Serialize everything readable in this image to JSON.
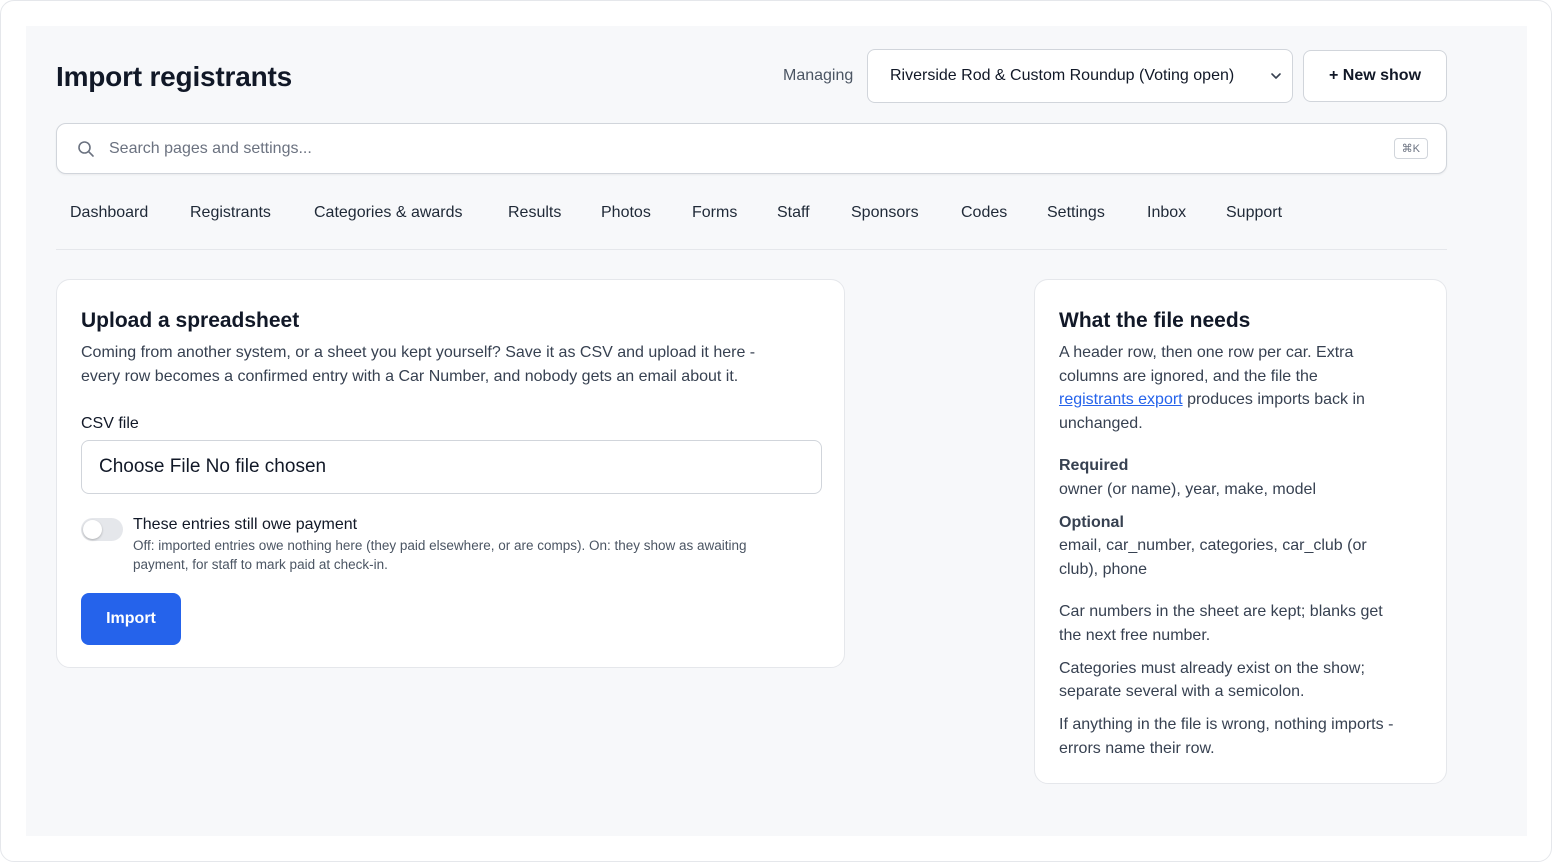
{
  "header": {
    "title": "Import registrants",
    "managing_label": "Managing",
    "show_select_value": "Riverside Rod & Custom Roundup (Voting open)",
    "new_show_label": "+ New show"
  },
  "search": {
    "placeholder": "Search pages and settings...",
    "shortcut": "⌘K"
  },
  "nav": {
    "items": [
      "Dashboard",
      "Registrants",
      "Categories & awards",
      "Results",
      "Photos",
      "Forms",
      "Staff",
      "Sponsors",
      "Codes",
      "Settings",
      "Inbox",
      "Support"
    ]
  },
  "upload": {
    "title": "Upload a spreadsheet",
    "desc_line1": "Coming from another system, or a sheet you kept yourself? Save it as CSV and upload it here -",
    "desc_line2": "every row becomes a confirmed entry with a Car Number, and nobody gets an email about it.",
    "csv_label": "CSV file",
    "file_button": "Choose File",
    "file_status": "No file chosen",
    "toggle_label": "These entries still owe payment",
    "toggle_help_line1": "Off: imported entries owe nothing here (they paid elsewhere, or are comps). On: they show as awaiting",
    "toggle_help_line2": "payment, for staff to mark paid at check-in.",
    "toggle_on": false,
    "import_button": "Import"
  },
  "needs": {
    "title": "What the file needs",
    "intro_line1": "A header row, then one row per car. Extra",
    "intro_line2": "columns are ignored, and the file the",
    "intro_link": "registrants export",
    "intro_line3_rest": "produces imports back in",
    "intro_line4": "unchanged.",
    "required_label": "Required",
    "required_fields": "owner (or name), year, make, model",
    "optional_label": "Optional",
    "optional_line1": "email, car_number, categories, car_club (or",
    "optional_line2": "club), phone",
    "note1_line1": "Car numbers in the sheet are kept; blanks get",
    "note1_line2": "the next free number.",
    "note2_line1": "Categories must already exist on the show;",
    "note2_line2": "separate several with a semicolon.",
    "note3_line1": "If anything in the file is wrong, nothing imports -",
    "note3_line2": "errors name their row."
  },
  "colors": {
    "accent": "#2563eb",
    "background": "#f7f8fa",
    "text": "#111827"
  }
}
